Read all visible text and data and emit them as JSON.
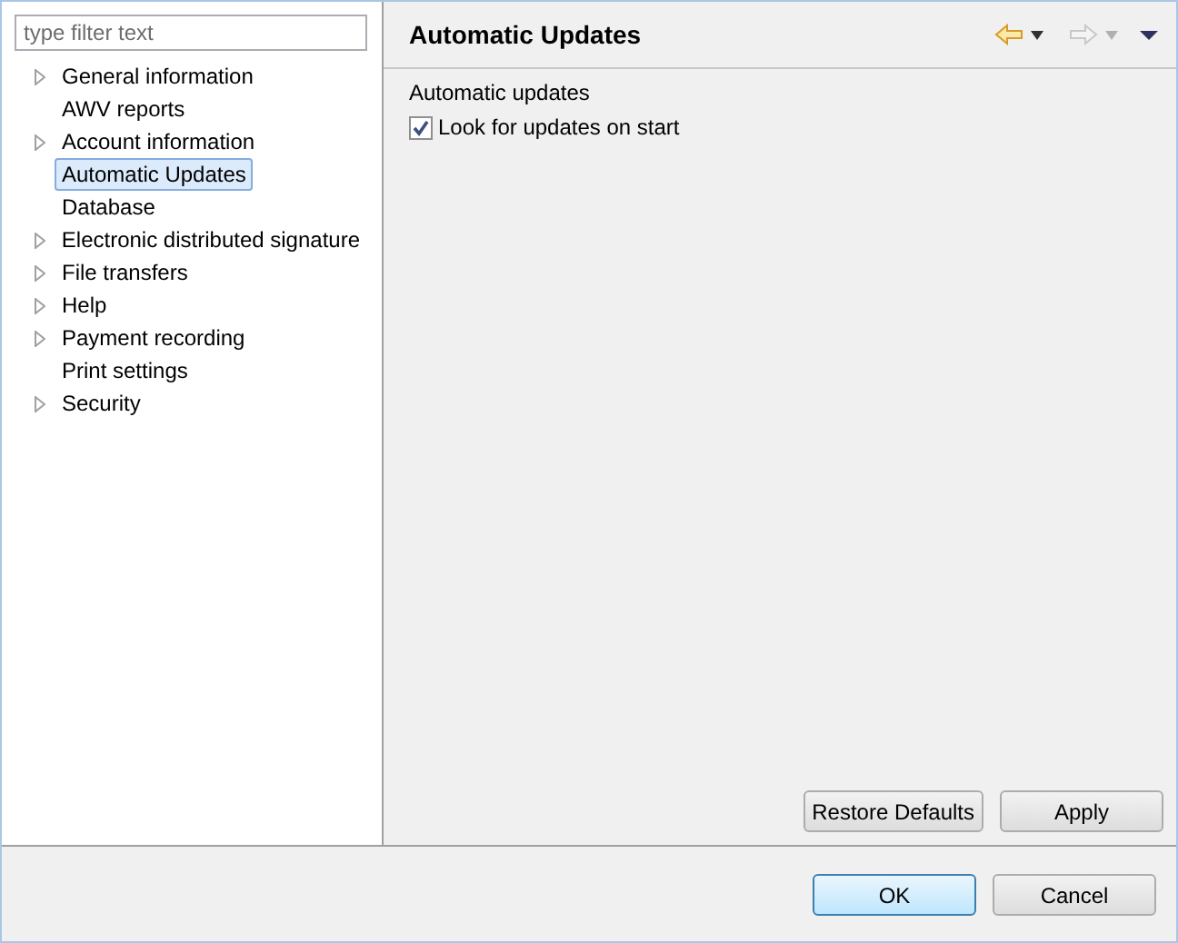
{
  "filter": {
    "placeholder": "type filter text"
  },
  "tree": [
    {
      "label": "General information",
      "expandable": true,
      "selected": false
    },
    {
      "label": "AWV reports",
      "expandable": false,
      "selected": false
    },
    {
      "label": "Account information",
      "expandable": true,
      "selected": false
    },
    {
      "label": "Automatic Updates",
      "expandable": false,
      "selected": true
    },
    {
      "label": "Database",
      "expandable": false,
      "selected": false
    },
    {
      "label": "Electronic distributed signature",
      "expandable": true,
      "selected": false
    },
    {
      "label": "File transfers",
      "expandable": true,
      "selected": false
    },
    {
      "label": "Help",
      "expandable": true,
      "selected": false
    },
    {
      "label": "Payment recording",
      "expandable": true,
      "selected": false
    },
    {
      "label": "Print settings",
      "expandable": false,
      "selected": false
    },
    {
      "label": "Security",
      "expandable": true,
      "selected": false
    }
  ],
  "page": {
    "title": "Automatic Updates",
    "back_disabled": false,
    "forward_disabled": true,
    "group_label": "Automatic updates",
    "options": [
      {
        "label": "Look for updates on start",
        "checked": true
      }
    ],
    "buttons": [
      "Restore Defaults",
      "Apply"
    ]
  },
  "dialog_buttons": [
    {
      "label": "OK",
      "default": true
    },
    {
      "label": "Cancel",
      "default": false
    }
  ]
}
